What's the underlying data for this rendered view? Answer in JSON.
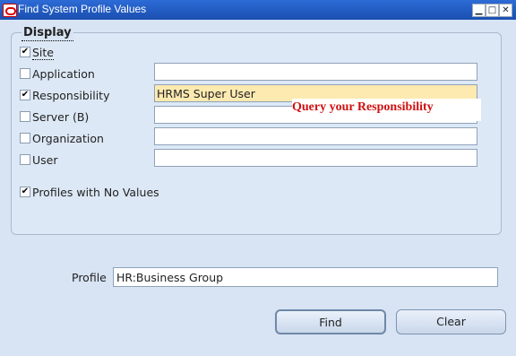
{
  "window": {
    "title": "Find System Profile Values",
    "minimize": "▁",
    "maximize": "□",
    "close": "✕"
  },
  "display": {
    "legend": "Display",
    "options": [
      {
        "label": "Site",
        "checked": true
      },
      {
        "label": "Application",
        "checked": false
      },
      {
        "label": "Responsibility",
        "checked": true
      },
      {
        "label": "Server (B)",
        "checked": false
      },
      {
        "label": "Organization",
        "checked": false
      },
      {
        "label": "User",
        "checked": false
      }
    ],
    "responsibility_value": "HRMS Super User",
    "annotation": "Query your Responsibility",
    "profiles_no_values": {
      "label": "Profiles with No Values",
      "checked": true
    }
  },
  "profile": {
    "label": "Profile",
    "value": "HR:Business Group"
  },
  "buttons": {
    "find": "Find",
    "clear": "Clear"
  },
  "check_mark": "✔"
}
